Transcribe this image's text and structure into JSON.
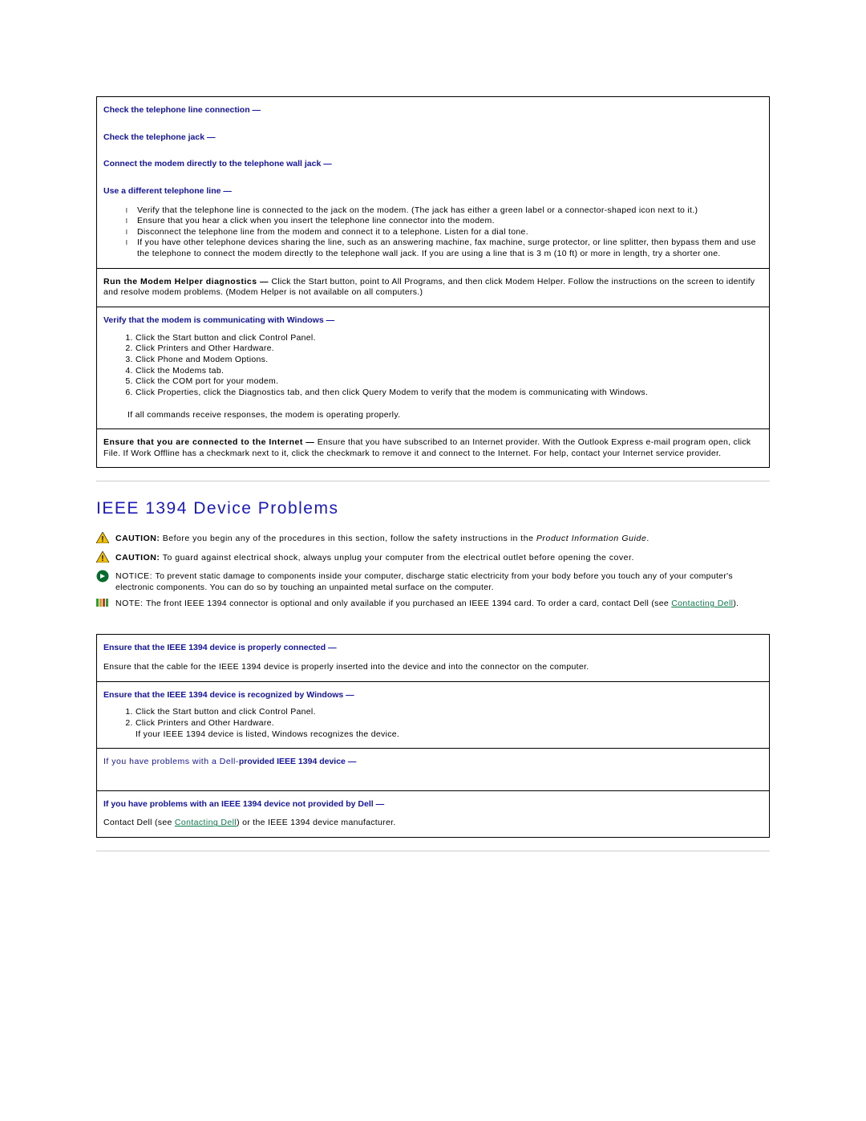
{
  "modem": {
    "check_line": "Check the telephone line connection",
    "check_jack": "Check the telephone jack",
    "connect_direct": "Connect the modem directly to the telephone wall jack",
    "use_diff": "Use a different telephone line",
    "dash": " —",
    "bullets": {
      "b1": "Verify that the telephone line is connected to the jack on the modem. (The jack has either a green label or a connector-shaped icon next to it.)",
      "b2": "Ensure that you hear a click when you insert the telephone line connector into the modem.",
      "b3": "Disconnect the telephone line from the modem and connect it to a telephone. Listen for a dial tone.",
      "b4": "If you have other telephone devices sharing the line, such as an answering machine, fax machine, surge protector, or line splitter, then bypass them and use the telephone to connect the modem directly to the telephone wall jack. If you are using a line that is 3 m (10 ft) or more in length, try a shorter one."
    },
    "run_helper_label": "Run the Modem Helper diagnostics — ",
    "run_helper_text": "Click the Start button, point to All Programs, and then click Modem Helper. Follow the instructions on the screen to identify and resolve modem problems. (Modem Helper is not available on all computers.)",
    "verify_comm": "Verify that the modem is communicating with Windows",
    "steps": {
      "s1": "Click the Start button and click Control Panel.",
      "s2": "Click Printers and Other Hardware.",
      "s3": "Click Phone and Modem Options.",
      "s4": "Click the Modems tab.",
      "s5": "Click the COM port for your modem.",
      "s6": "Click Properties, click the Diagnostics tab, and then click Query Modem to verify that the modem is communicating with Windows."
    },
    "steps_footer": "If all commands receive responses, the modem is operating properly.",
    "ensure_internet_label": "Ensure that you are connected to the Internet — ",
    "ensure_internet_text": "Ensure that you have subscribed to an Internet provider. With the Outlook Express e-mail program open, click File. If Work Offline has a checkmark next to it, click the checkmark to remove it and connect to the Internet. For help, contact your Internet service provider."
  },
  "ieee": {
    "heading": "IEEE 1394 Device Problems",
    "caution_label": "CAUTION: ",
    "caution1_a": "Before you begin any of the procedures in this section, follow the safety instructions in the ",
    "caution1_b": "Product Information Guide",
    "caution1_c": ".",
    "caution2": "To guard against electrical shock, always unplug your computer from the electrical outlet before opening the cover.",
    "notice_label": "NOTICE: ",
    "notice": "To prevent static damage to components inside your computer, discharge static electricity from your body before you touch any of your computer's electronic components. You can do so by touching an unpainted metal surface on the computer.",
    "note_label": "NOTE: ",
    "note_a": "The front IEEE 1394 connector is optional and only available if you purchased an IEEE 1394 card. To order a card, contact Dell (see ",
    "note_link": "Contacting Dell",
    "note_b": ").",
    "cell1_label": "Ensure that the IEEE 1394 device is properly connected",
    "cell1_text": "Ensure that the cable for the IEEE 1394 device is properly inserted into the device and into the connector on the computer.",
    "cell2_label": "Ensure that the IEEE 1394 device is recognized by Windows",
    "cell2_s1": "Click the Start button and click Control Panel.",
    "cell2_s2a": "Click Printers and Other Hardware.",
    "cell2_s2b": "If your IEEE 1394 device is listed, Windows recognizes the device.",
    "cell3a": "If you have problems with a Dell-",
    "cell3b": "provided IEEE 1394 device",
    "cell4_label": "If you have problems with an IEEE 1394 device not provided by Dell",
    "cell4_a": "Contact Dell (see ",
    "cell4_link": "Contacting Dell",
    "cell4_b": ") or the IEEE 1394 device manufacturer."
  }
}
